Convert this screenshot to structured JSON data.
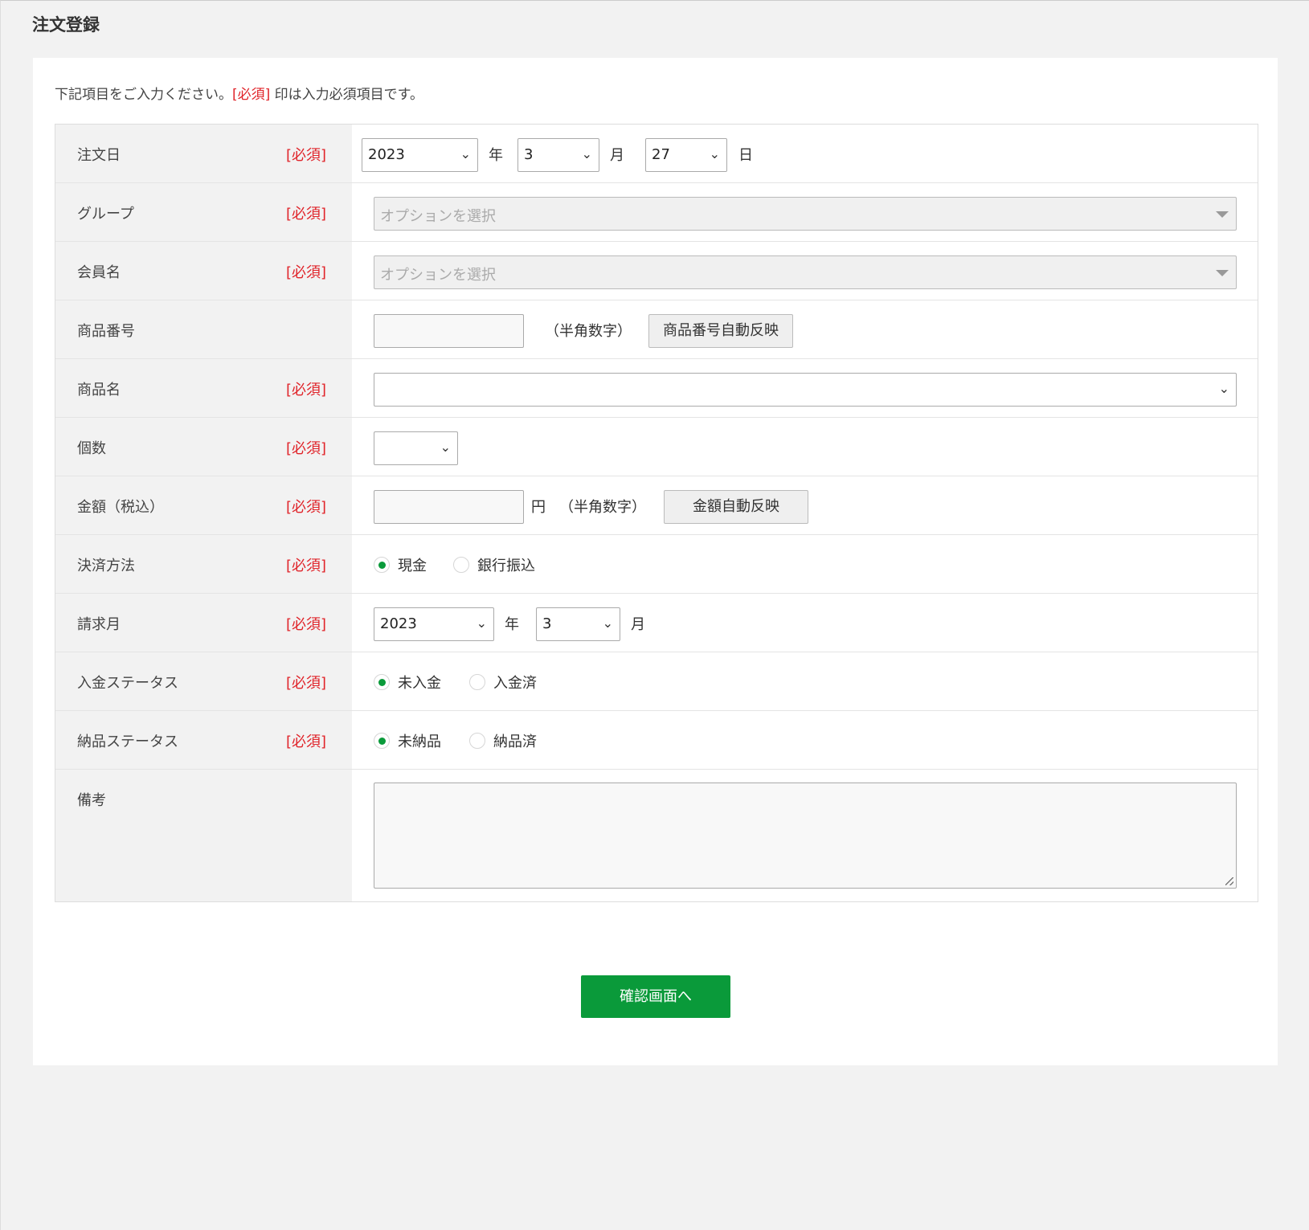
{
  "page_title": "注文登録",
  "intro": {
    "before": "下記項目をご入力ください。",
    "req_mark": "[必須]",
    "after": " 印は入力必須項目です。"
  },
  "required_label": "[必須]",
  "fields": {
    "order_date": {
      "label": "注文日",
      "year": "2023",
      "year_unit": "年",
      "month": "3",
      "month_unit": "月",
      "day": "27",
      "day_unit": "日"
    },
    "group": {
      "label": "グループ",
      "placeholder": "オプションを選択"
    },
    "member_name": {
      "label": "会員名",
      "placeholder": "オプションを選択"
    },
    "product_number": {
      "label": "商品番号",
      "value": "",
      "hint": "（半角数字）",
      "auto_button": "商品番号自動反映"
    },
    "product_name": {
      "label": "商品名",
      "value": ""
    },
    "quantity": {
      "label": "個数",
      "value": ""
    },
    "amount": {
      "label": "金額（税込）",
      "value": "",
      "unit": "円",
      "hint": "（半角数字）",
      "auto_button": "金額自動反映"
    },
    "payment_method": {
      "label": "決済方法",
      "options": [
        "現金",
        "銀行振込"
      ],
      "selected": "現金"
    },
    "billing_month": {
      "label": "請求月",
      "year": "2023",
      "year_unit": "年",
      "month": "3",
      "month_unit": "月"
    },
    "payment_status": {
      "label": "入金ステータス",
      "options": [
        "未入金",
        "入金済"
      ],
      "selected": "未入金"
    },
    "delivery_status": {
      "label": "納品ステータス",
      "options": [
        "未納品",
        "納品済"
      ],
      "selected": "未納品"
    },
    "remarks": {
      "label": "備考",
      "value": ""
    }
  },
  "submit_label": "確認画面へ",
  "colors": {
    "required": "#e0242a",
    "accent": "#0a9a3a",
    "background": "#f2f2f2"
  }
}
